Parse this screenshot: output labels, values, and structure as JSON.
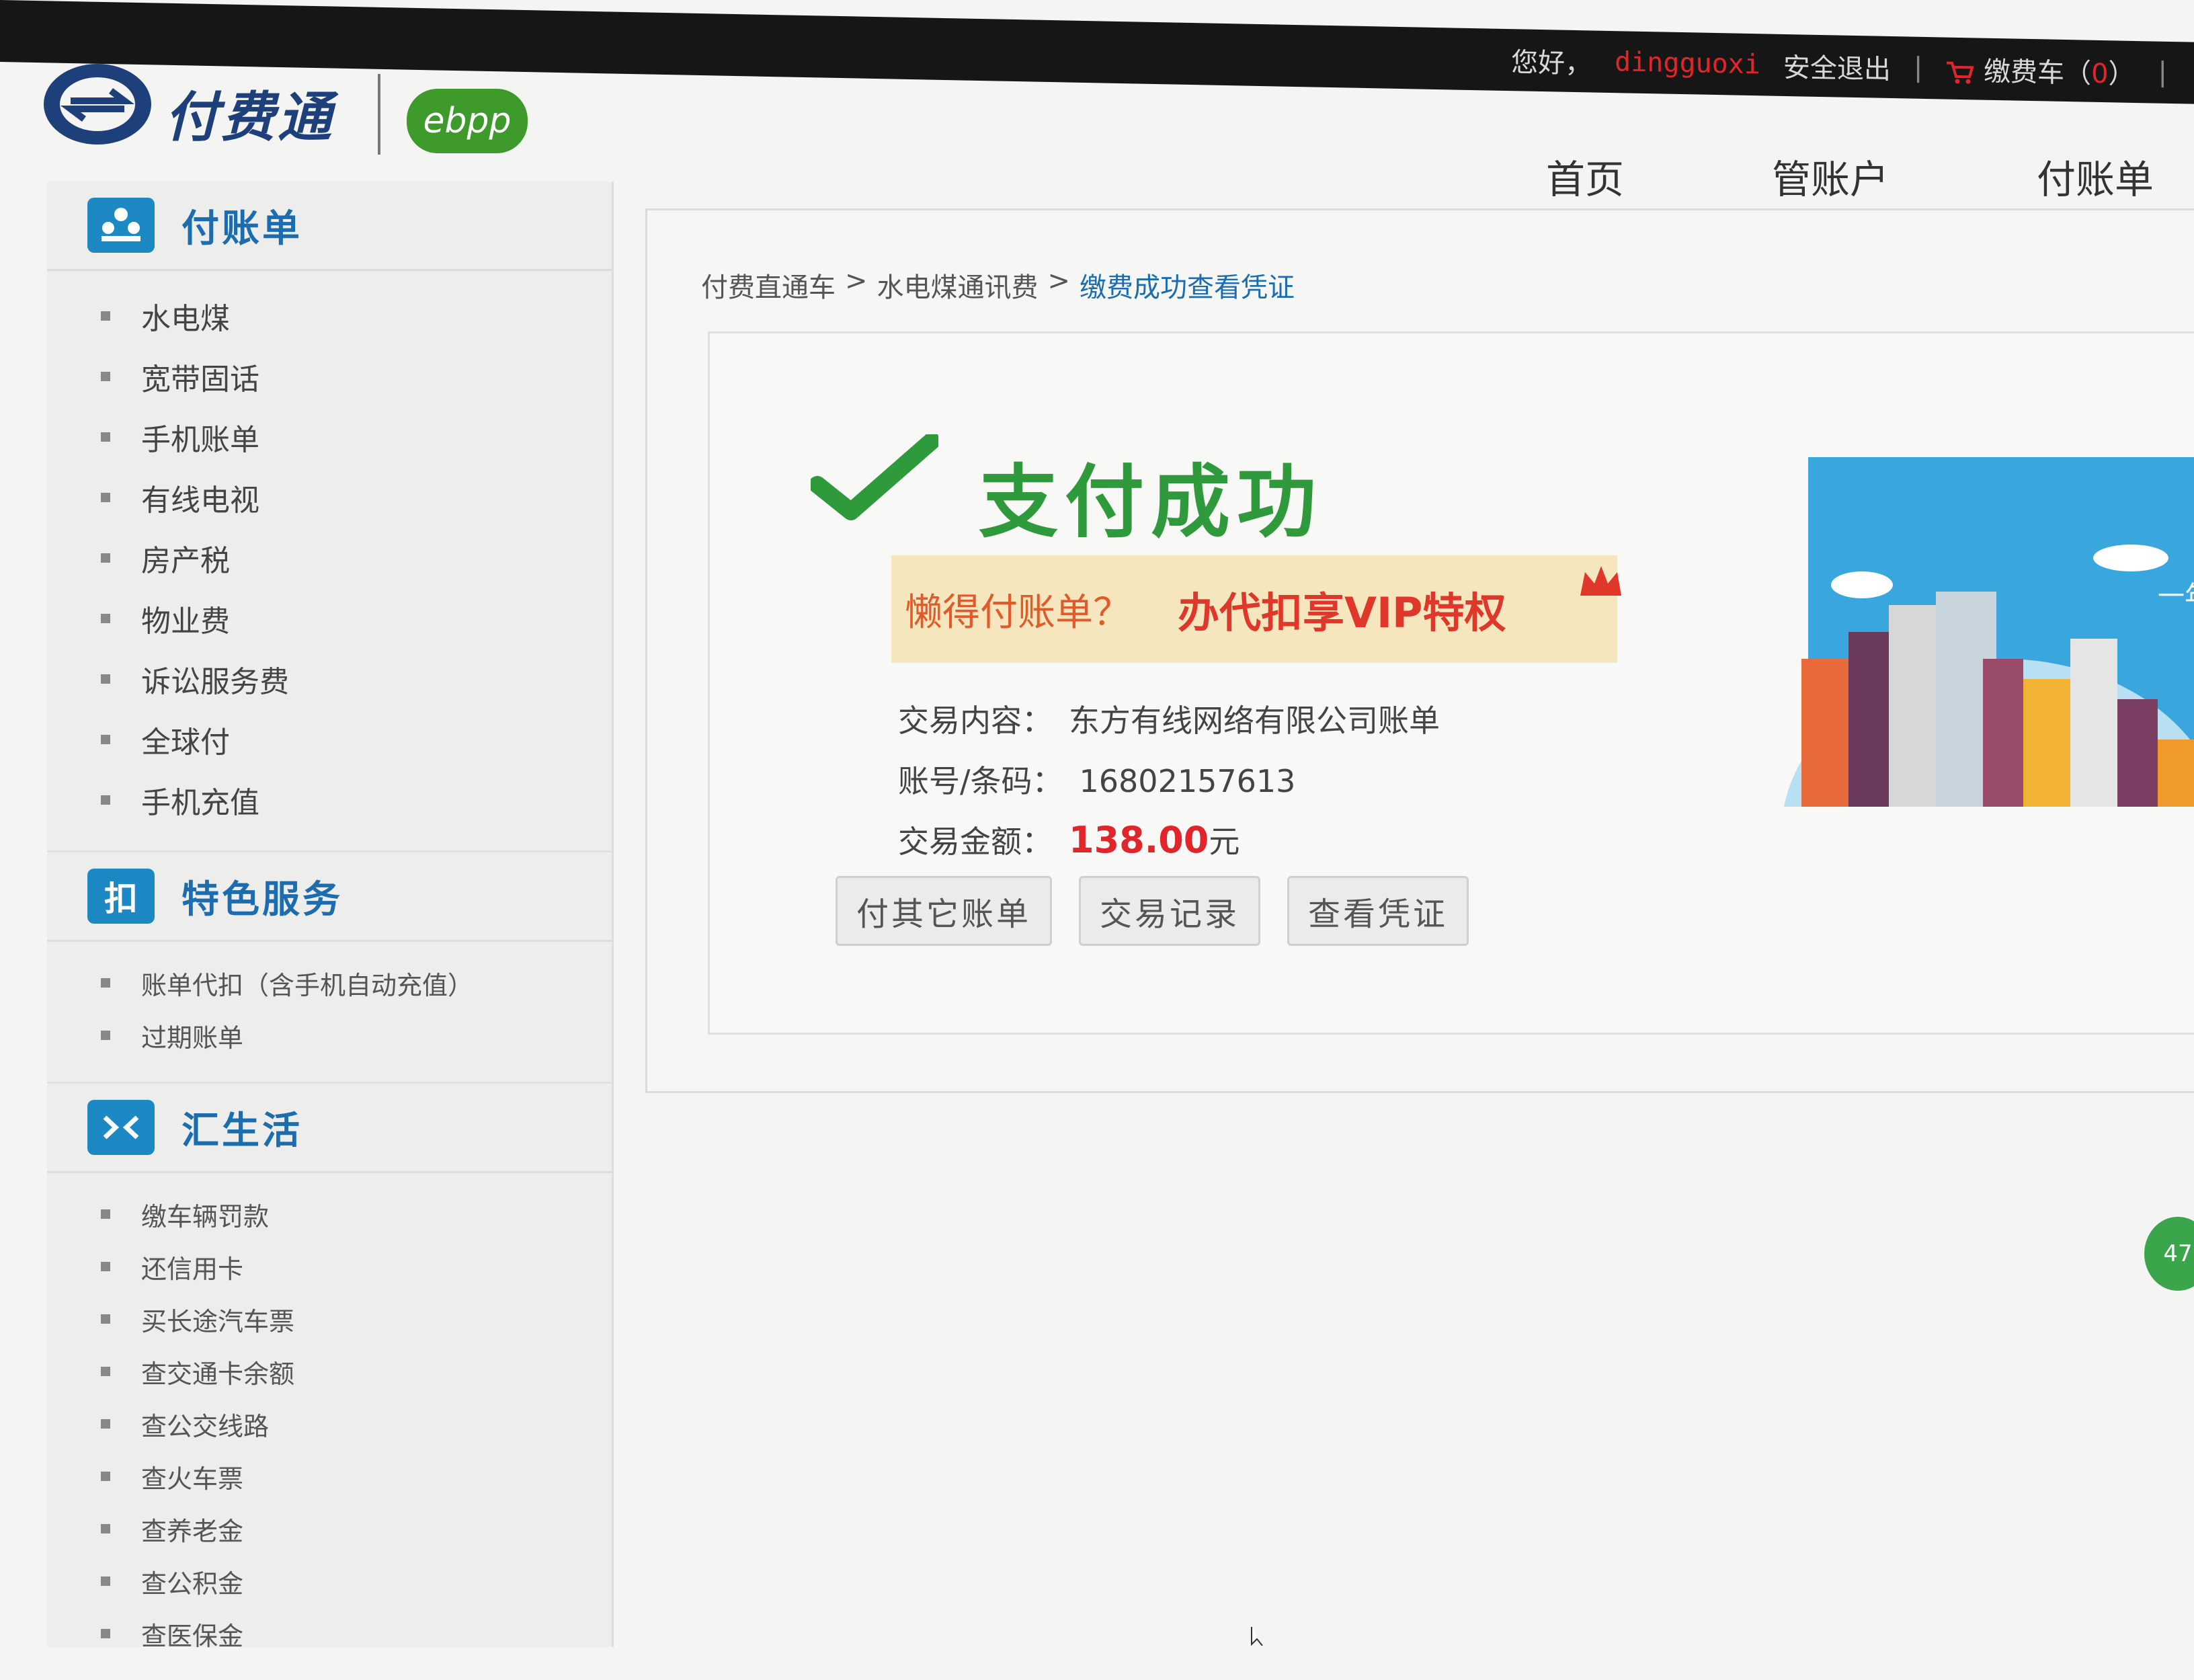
{
  "topbar": {
    "greeting": "您好，",
    "username": "dingguoxi",
    "logout": "安全退出",
    "separator": "|",
    "cart_label": "缴费车（",
    "cart_count": "0",
    "cart_close": "）",
    "trailing_sep": "|"
  },
  "brand": {
    "logo_text": "付费通",
    "badge": "ebpp"
  },
  "main_nav": [
    "首页",
    "管账户",
    "付账单"
  ],
  "sidebar": {
    "sections": [
      {
        "title": "付账单",
        "icon": "people-icon",
        "items": [
          "水电煤",
          "宽带固话",
          "手机账单",
          "有线电视",
          "房产税",
          "物业费",
          "诉讼服务费",
          "全球付",
          "手机充值"
        ]
      },
      {
        "title": "特色服务",
        "icon_text": "扣",
        "items": [
          "账单代扣（含手机自动充值）",
          "过期账单"
        ]
      },
      {
        "title": "汇生活",
        "icon": "life-icon",
        "items": [
          "缴车辆罚款",
          "还信用卡",
          "买长途汽车票",
          "查交通卡余额",
          "查公交线路",
          "查火车票",
          "查养老金",
          "查公积金",
          "查医保金"
        ]
      }
    ]
  },
  "breadcrumb": {
    "item1": "付费直通车",
    "sep1": ">",
    "item2": "水电煤通讯费",
    "sep2": ">",
    "current": "缴费成功查看凭证"
  },
  "result": {
    "title": "支付成功",
    "promo_question": "懒得付账单？",
    "promo_vip": "办代扣享VIP特权",
    "content_label": "交易内容：",
    "content_value": "东方有线网络有限公司账单",
    "account_label": "账号/条码：",
    "account_value": "16802157613",
    "amount_label": "交易金额：",
    "amount_value": "138.00",
    "amount_unit": "元",
    "buttons": [
      "付其它账单",
      "交易记录",
      "查看凭证"
    ]
  },
  "banner": {
    "text": "一年"
  },
  "float_badge": "47",
  "colors": {
    "brand_blue": "#1c6db0",
    "success_green": "#2f9a3b",
    "alert_red": "#e0262b",
    "promo_bg": "#f5e6bd"
  }
}
